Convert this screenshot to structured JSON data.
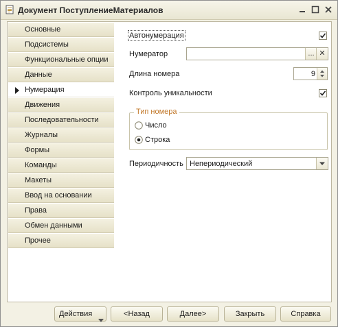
{
  "window": {
    "title": "Документ ПоступлениеМатериалов"
  },
  "nav": {
    "items": [
      {
        "label": "Основные"
      },
      {
        "label": "Подсистемы"
      },
      {
        "label": "Функциональные опции"
      },
      {
        "label": "Данные"
      },
      {
        "label": "Нумерация",
        "active": true
      },
      {
        "label": "Движения"
      },
      {
        "label": "Последовательности"
      },
      {
        "label": "Журналы"
      },
      {
        "label": "Формы"
      },
      {
        "label": "Команды"
      },
      {
        "label": "Макеты"
      },
      {
        "label": "Ввод на основании"
      },
      {
        "label": "Права"
      },
      {
        "label": "Обмен данными"
      },
      {
        "label": "Прочее"
      }
    ]
  },
  "form": {
    "autonumbering_label": "Автонумерация",
    "autonumbering_checked": true,
    "numerator_label": "Нумератор",
    "numerator_value": "",
    "numerator_select_glyph": "...",
    "numerator_clear_glyph": "✕",
    "length_label": "Длина номера",
    "length_value": "9",
    "uniqueness_label": "Контроль уникальности",
    "uniqueness_checked": true,
    "number_type_group": "Тип номера",
    "number_type_options": [
      {
        "label": "Число",
        "selected": false
      },
      {
        "label": "Строка",
        "selected": true
      }
    ],
    "periodicity_label": "Периодичность",
    "periodicity_value": "Непериодический"
  },
  "buttons": {
    "actions": "Действия",
    "back": "<Назад",
    "next": "Далее>",
    "close": "Закрыть",
    "help": "Справка"
  },
  "colors": {
    "accent_group_title": "#c2792b",
    "panel_bg": "#f3f1e4"
  },
  "icons": {
    "app": "document-icon",
    "minimize": "minimize-icon",
    "maximize": "maximize-icon",
    "close": "close-icon"
  }
}
